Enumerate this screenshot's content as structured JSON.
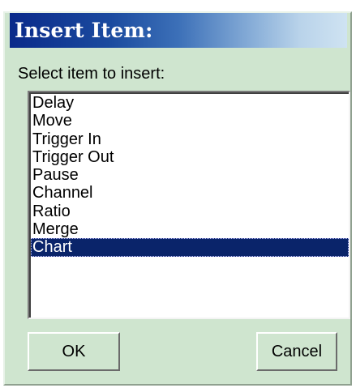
{
  "dialog": {
    "title": "Insert Item:",
    "prompt": "Select item to insert:"
  },
  "list": {
    "items": [
      {
        "label": "Delay"
      },
      {
        "label": "Move"
      },
      {
        "label": "Trigger In"
      },
      {
        "label": "Trigger Out"
      },
      {
        "label": "Pause"
      },
      {
        "label": "Channel"
      },
      {
        "label": "Ratio"
      },
      {
        "label": "Merge"
      },
      {
        "label": "Chart"
      }
    ],
    "selected": "Chart"
  },
  "buttons": {
    "ok_label": "OK",
    "cancel_label": "Cancel"
  },
  "colors": {
    "dialog_background": "#cfe5cf",
    "title_gradient_start": "#0a2a8a",
    "selection_background": "#0a246a",
    "selection_text": "#ffffff"
  }
}
